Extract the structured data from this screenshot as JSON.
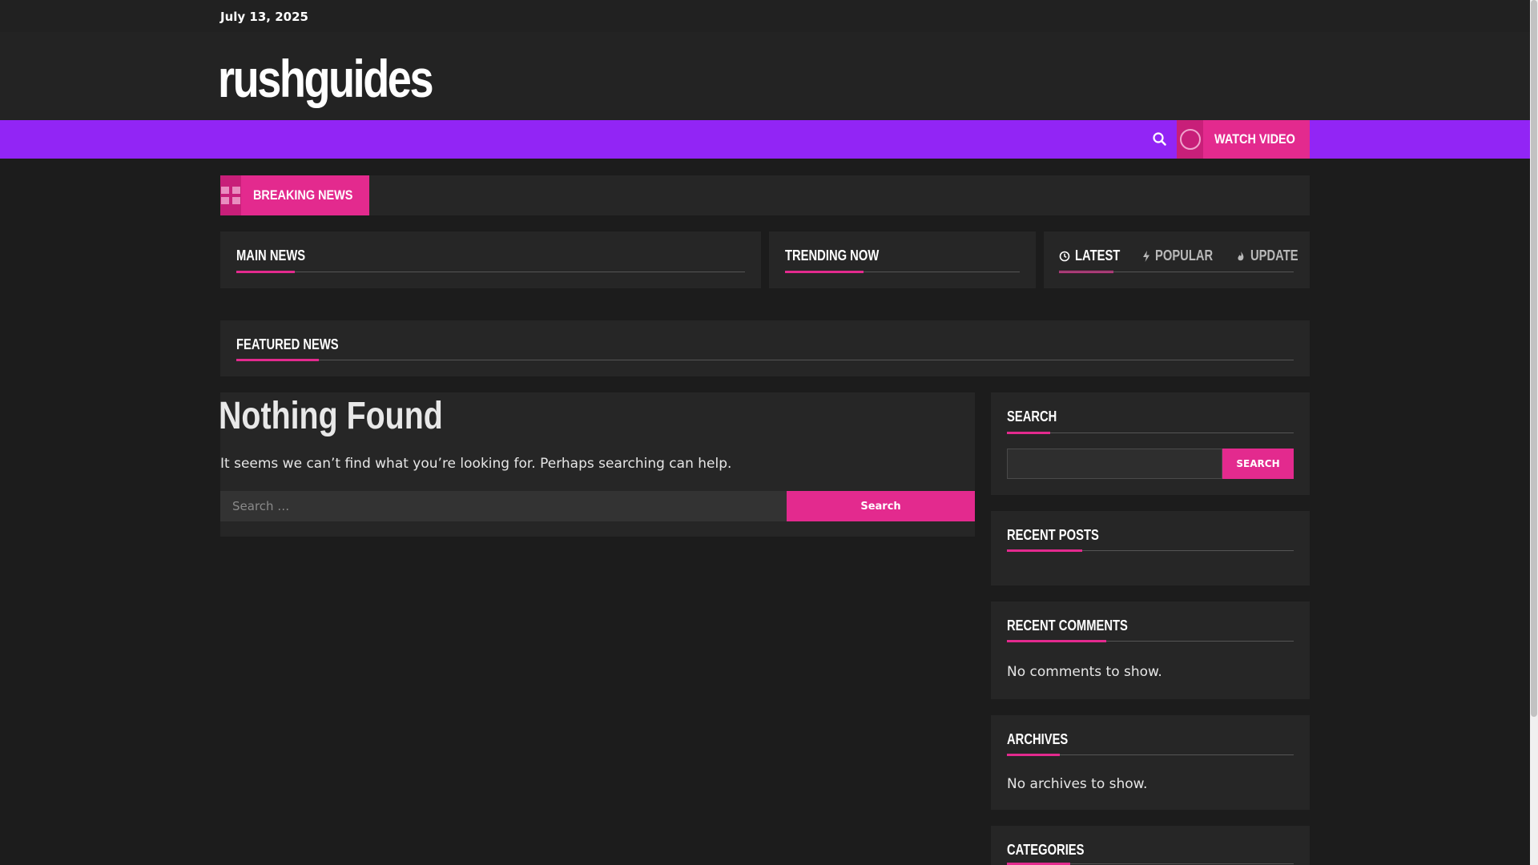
{
  "topbar": {
    "date": "July 13, 2025"
  },
  "header": {
    "site_title": "rushguides"
  },
  "nav": {
    "search_icon": "search-icon",
    "watch_video_label": "WATCH VIDEO"
  },
  "breaking": {
    "label": "BREAKING NEWS"
  },
  "sections": {
    "main_news": "MAIN NEWS",
    "trending_now": "TRENDING NOW",
    "featured_news": "FEATURED NEWS"
  },
  "tabs": [
    {
      "label": "LATEST",
      "icon": "clock-icon"
    },
    {
      "label": "POPULAR",
      "icon": "bolt-icon"
    },
    {
      "label": "UPDATE",
      "icon": "flame-icon"
    }
  ],
  "main": {
    "heading": "Nothing Found",
    "message": "It seems we can’t find what you’re looking for. Perhaps searching can help.",
    "search_placeholder": "Search …",
    "search_button": "Search"
  },
  "sidebar": {
    "search_title": "SEARCH",
    "search_button": "SEARCH",
    "recent_posts_title": "RECENT POSTS",
    "recent_comments_title": "RECENT COMMENTS",
    "recent_comments_text": "No comments to show.",
    "archives_title": "ARCHIVES",
    "archives_text": "No archives to show.",
    "categories_title": "CATEGORIES"
  },
  "colors": {
    "accent": "#e32a8e",
    "nav": "#9225f5",
    "background": "#1c1c1c",
    "panel": "#262626"
  }
}
